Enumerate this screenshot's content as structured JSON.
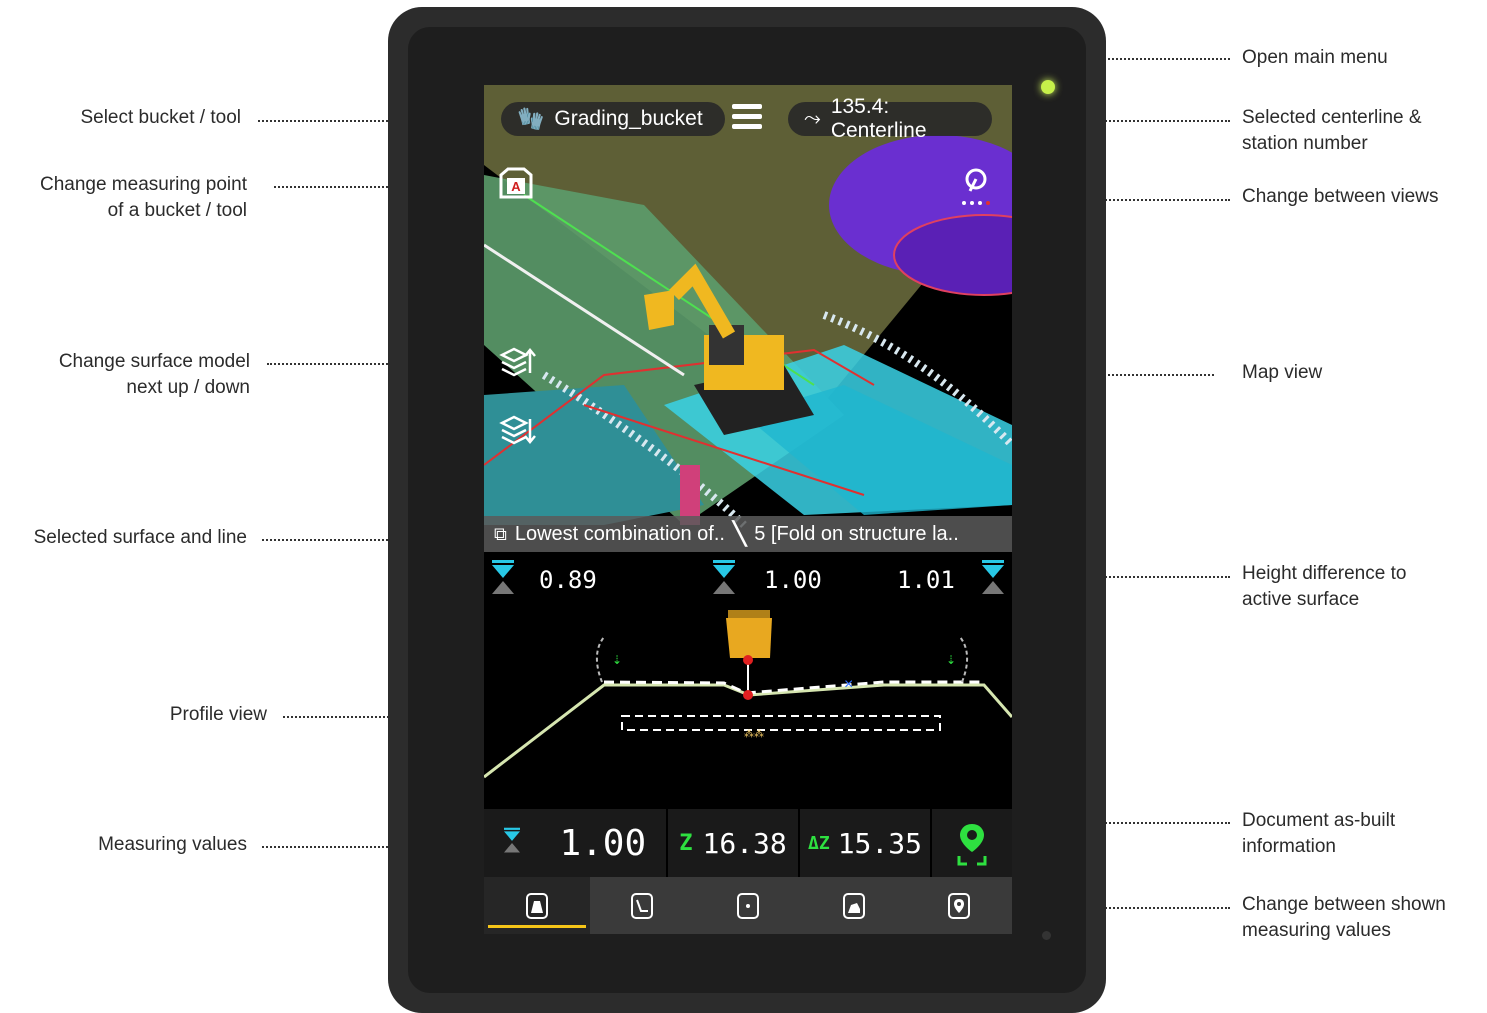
{
  "annotations": {
    "select_bucket": "Select bucket / tool",
    "measuring_point_1": "Change measuring point",
    "measuring_point_2": "of a bucket / tool",
    "surface_model_1": "Change surface model",
    "surface_model_2": "next up / down",
    "selected_surface": "Selected surface and line",
    "profile_view": "Profile view",
    "measuring_values": "Measuring values",
    "open_main_menu": "Open main menu",
    "centerline_1": "Selected centerline &",
    "centerline_2": "station number",
    "change_views": "Change between views",
    "map_view": "Map view",
    "height_diff_1": "Height difference to",
    "height_diff_2": "active surface",
    "document_1": "Document as-built",
    "document_2": "information",
    "change_values_1": "Change between shown",
    "change_values_2": "measuring values"
  },
  "topbar": {
    "bucket_name": "Grading_bucket",
    "centerline": "135.4: Centerline"
  },
  "measuring_point_label": "A",
  "infobar": {
    "surface": "Lowest combination of..",
    "line": "5 [Fold on structure la.."
  },
  "profile": {
    "left_value": "0.89",
    "center_value": "1.00",
    "right_value": "1.01"
  },
  "measure": {
    "height_diff": "1.00",
    "z_label": "Z",
    "z_value": "16.38",
    "dz_label": "ΔZ",
    "dz_value": "15.35"
  },
  "colors": {
    "accent_yellow": "#f5c518",
    "cyan": "#28c8e6",
    "green": "#2ee040",
    "panel": "#1a1a1a"
  },
  "tabs": [
    "cross-section-icon",
    "line-icon",
    "point-icon",
    "bucket-icon",
    "location-icon"
  ]
}
